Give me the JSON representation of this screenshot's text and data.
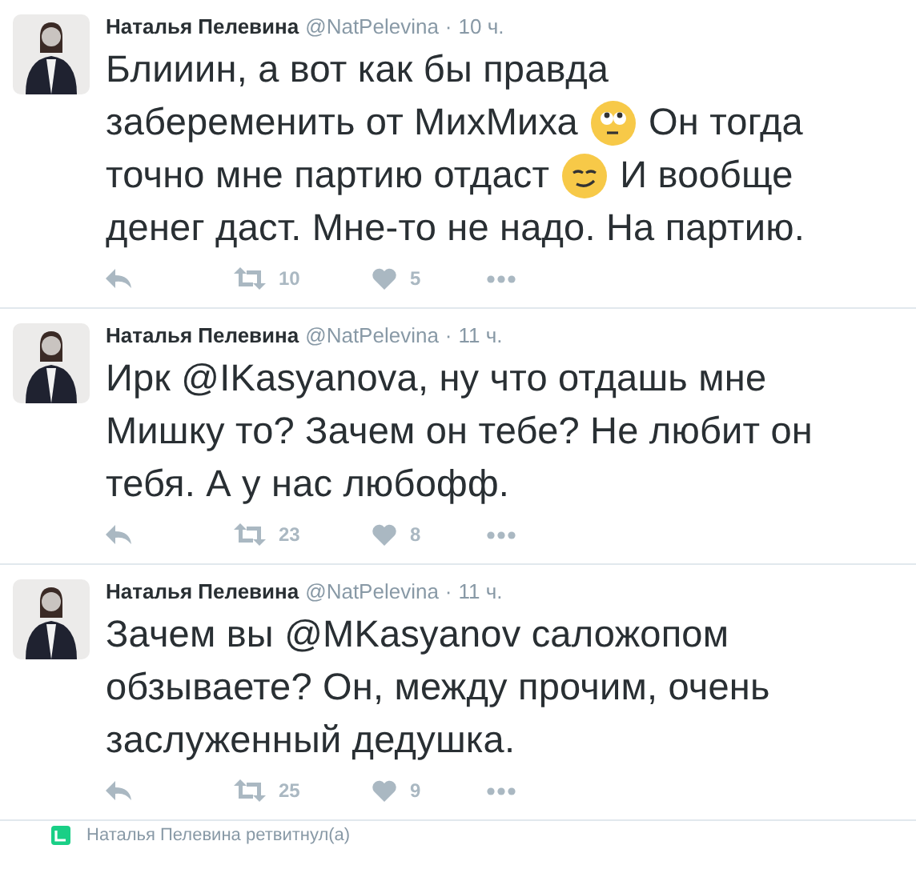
{
  "tweets": [
    {
      "name": "Наталья Пелевина",
      "handle": "@NatPelevina",
      "separator": "·",
      "time": "10 ч.",
      "lines": [
        [
          {
            "kind": "text",
            "text": "Блииин, а вот как бы правда"
          }
        ],
        [
          {
            "kind": "text",
            "text": "забеременить от МихМиха"
          },
          {
            "kind": "emoji"
          },
          {
            "kind": "text",
            "text": "Он тогда"
          }
        ],
        [
          {
            "kind": "text",
            "text": "точно мне партию отдаст"
          },
          {
            "kind": "emoji"
          },
          {
            "kind": "text",
            "text": "И вообще"
          }
        ],
        [
          {
            "kind": "text",
            "text": "денег даст. Мне-то не надо. На партию."
          }
        ]
      ],
      "retweets": "10",
      "likes": "5"
    },
    {
      "name": "Наталья Пелевина",
      "handle": "@NatPelevina",
      "separator": "·",
      "time": "11 ч.",
      "lines": [
        [
          {
            "kind": "text",
            "text": "Ирк "
          },
          {
            "kind": "mention",
            "text": "@IKasyanova"
          },
          {
            "kind": "text",
            "text": ", ну что отдашь мне"
          }
        ],
        [
          {
            "kind": "text",
            "text": "Мишку то? Зачем он тебе? Не любит он"
          }
        ],
        [
          {
            "kind": "text",
            "text": "тебя. А у нас любофф."
          }
        ]
      ],
      "retweets": "23",
      "likes": "8"
    },
    {
      "name": "Наталья Пелевина",
      "handle": "@NatPelevina",
      "separator": "·",
      "time": "11 ч.",
      "lines": [
        [
          {
            "kind": "text",
            "text": "Зачем вы "
          },
          {
            "kind": "mention",
            "text": "@MKasyanov"
          },
          {
            "kind": "text",
            "text": " саложопом"
          }
        ],
        [
          {
            "kind": "text",
            "text": "обзываете? Он, между прочим, очень"
          }
        ],
        [
          {
            "kind": "text",
            "text": "заслуженный дедушка."
          }
        ]
      ],
      "retweets": "25",
      "likes": "9"
    }
  ],
  "footer": {
    "text": "Наталья Пелевина ретвитнул(а)"
  }
}
